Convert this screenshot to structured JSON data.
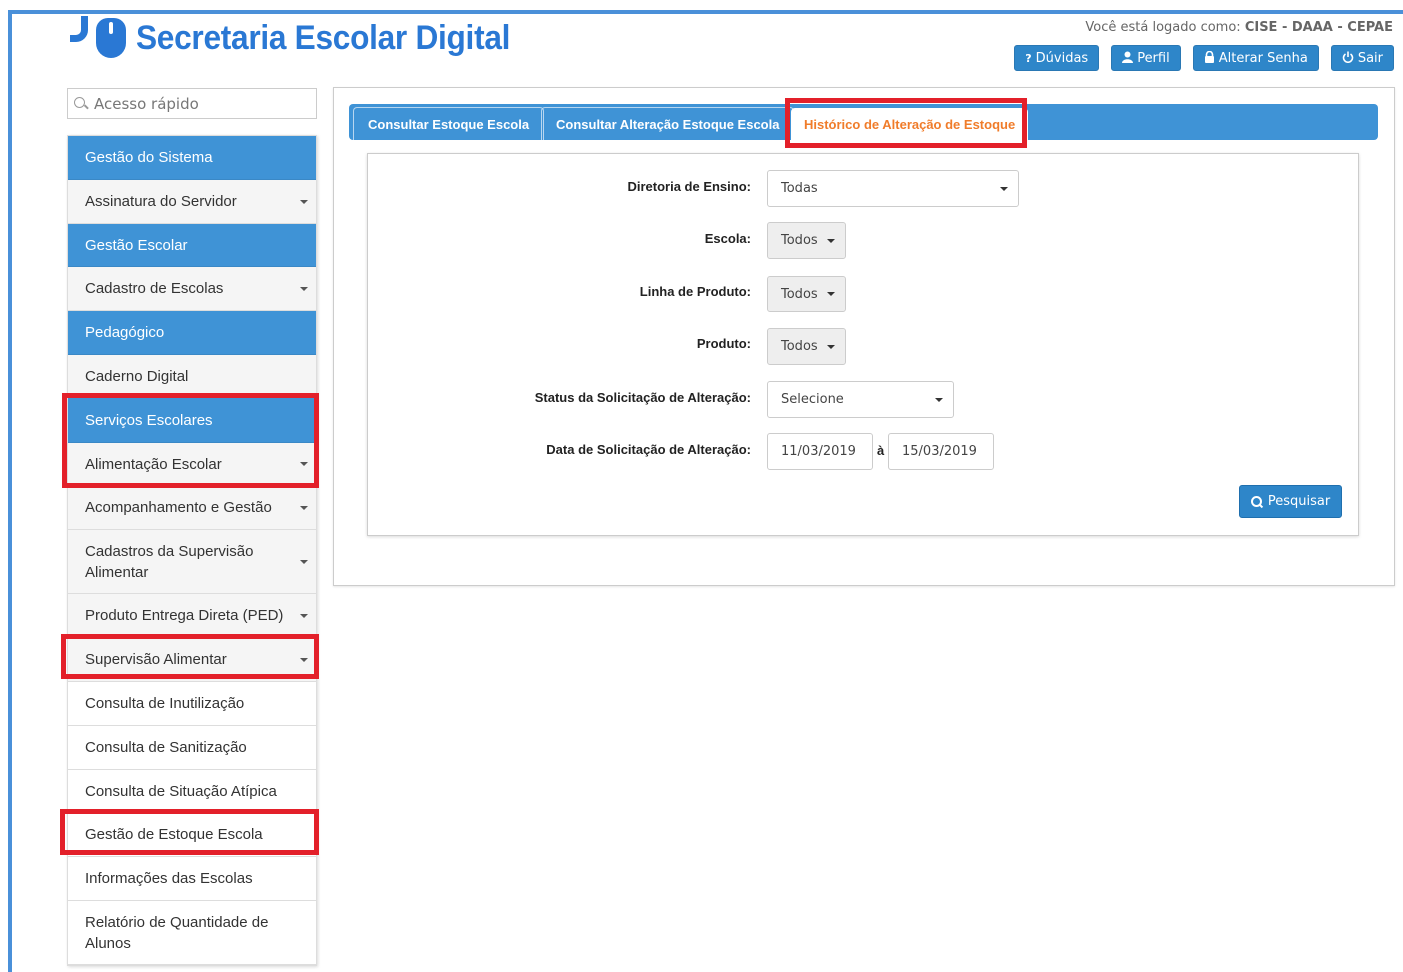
{
  "header": {
    "app_title": "Secretaria Escolar Digital",
    "login_prefix": "Você está logado como: ",
    "login_user": "CISE - DAAA - CEPAE",
    "buttons": [
      {
        "icon": "question-icon",
        "label": "Dúvidas"
      },
      {
        "icon": "user-icon",
        "label": "Perfil"
      },
      {
        "icon": "lock-icon",
        "label": "Alterar Senha"
      },
      {
        "icon": "power-icon",
        "label": "Sair"
      }
    ]
  },
  "search": {
    "placeholder": "Acesso rápido"
  },
  "sidebar": {
    "items": [
      {
        "label": "Gestão do Sistema",
        "type": "header"
      },
      {
        "label": "Assinatura do Servidor",
        "type": "item",
        "caret": true
      },
      {
        "label": "Gestão Escolar",
        "type": "header"
      },
      {
        "label": "Cadastro de Escolas",
        "type": "item",
        "caret": true
      },
      {
        "label": "Pedagógico",
        "type": "header"
      },
      {
        "label": "Caderno Digital",
        "type": "item",
        "caret": false
      },
      {
        "label": "Serviços Escolares",
        "type": "header"
      },
      {
        "label": "Alimentação Escolar",
        "type": "item",
        "caret": true
      },
      {
        "label": "Acompanhamento e Gestão",
        "type": "item",
        "caret": true
      },
      {
        "label": "Cadastros da Supervisão Alimentar",
        "type": "item",
        "caret": true
      },
      {
        "label": "Produto Entrega Direta (PED)",
        "type": "item",
        "caret": true
      },
      {
        "label": "Supervisão Alimentar",
        "type": "item",
        "caret": true
      },
      {
        "label": "Consulta de Inutilização",
        "type": "subitem"
      },
      {
        "label": "Consulta de Sanitização",
        "type": "subitem"
      },
      {
        "label": "Consulta de Situação Atípica",
        "type": "subitem"
      },
      {
        "label": "Gestão de Estoque Escola",
        "type": "subitem"
      },
      {
        "label": "Informações das Escolas",
        "type": "subitem"
      },
      {
        "label": "Relatório de Quantidade de Alunos",
        "type": "subitem"
      }
    ]
  },
  "tabs": [
    {
      "label": "Consultar Estoque Escola",
      "active": false
    },
    {
      "label": "Consultar Alteração Estoque Escola",
      "active": false
    },
    {
      "label": "Histórico de Alteração de Estoque",
      "active": true
    }
  ],
  "form": {
    "diretoria": {
      "label": "Diretoria de Ensino:",
      "value": "Todas"
    },
    "escola": {
      "label": "Escola:",
      "value": "Todos"
    },
    "linha_produto": {
      "label": "Linha de Produto:",
      "value": "Todos"
    },
    "produto": {
      "label": "Produto:",
      "value": "Todos"
    },
    "status": {
      "label": "Status da Solicitação de Alteração:",
      "value": "Selecione"
    },
    "data": {
      "label": "Data de Solicitação de Alteração:",
      "from": "11/03/2019",
      "separator": "à",
      "to": "15/03/2019"
    },
    "search_button": "Pesquisar"
  },
  "colors": {
    "primary": "#3f93d6",
    "brand": "#2a78d4",
    "active_tab_text": "#f07c2a",
    "highlight_border": "#e3202a"
  }
}
